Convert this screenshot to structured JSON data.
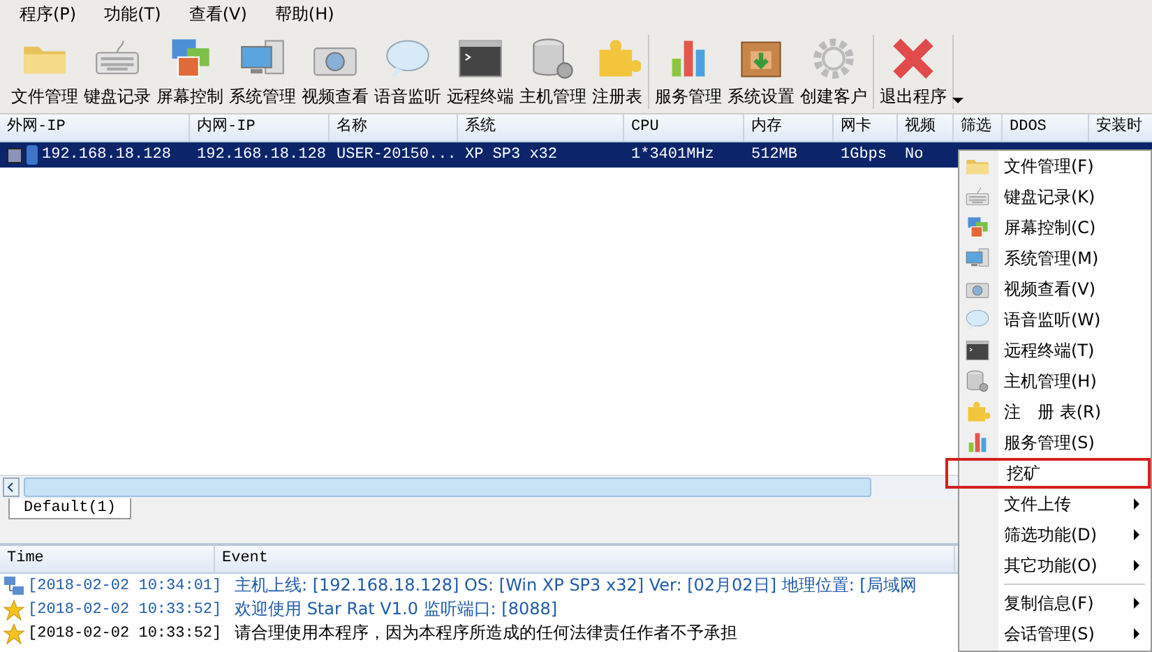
{
  "menu_bar": [
    "程序(P)",
    "功能(T)",
    "查看(V)",
    "帮助(H)"
  ],
  "toolbar": [
    {
      "items": [
        {
          "label": "文件管理",
          "kind": "folder"
        },
        {
          "label": "键盘记录",
          "kind": "keyboard"
        },
        {
          "label": "屏幕控制",
          "kind": "screens"
        },
        {
          "label": "系统管理",
          "kind": "monitor"
        },
        {
          "label": "视频查看",
          "kind": "camera"
        },
        {
          "label": "语音监听",
          "kind": "bubble"
        },
        {
          "label": "远程终端",
          "kind": "terminal"
        },
        {
          "label": "主机管理",
          "kind": "server"
        },
        {
          "label": "注册表",
          "kind": "puzzle"
        }
      ]
    },
    {
      "items": [
        {
          "label": "服务管理",
          "kind": "chart"
        },
        {
          "label": "系统设置",
          "kind": "box"
        },
        {
          "label": "创建客户",
          "kind": "gear"
        }
      ]
    },
    {
      "items": [
        {
          "label": "退出程序",
          "kind": "exit",
          "dropdown": true
        }
      ]
    }
  ],
  "table": {
    "columns": [
      "外网-IP",
      "内网-IP",
      "名称",
      "系统",
      "CPU",
      "内存",
      "网卡",
      "视频",
      "筛选",
      "DDOS",
      "安装时"
    ],
    "rows": [
      {
        "selected": true,
        "checked": false,
        "cells": [
          "192.168.18.128",
          "192.168.18.128",
          "USER-20150...",
          "XP SP3 x32",
          "1*3401MHz",
          "512MB",
          "1Gbps",
          "No"
        ]
      }
    ]
  },
  "tabs": [
    {
      "label": "Default(1)",
      "selected": true
    }
  ],
  "log": {
    "columns": [
      "Time",
      "Event"
    ],
    "rows": [
      {
        "kind": "online",
        "time": "[2018-02-02 10:34:01]",
        "event": "主机上线: [192.168.18.128]   OS: [Win XP SP3 x32]   Ver: [02月02日]   地理位置: [局域网"
      },
      {
        "kind": "notice",
        "time": "[2018-02-02 10:33:52]",
        "event": "欢迎使用 Star Rat  V1.0   监听端口: [8088]"
      },
      {
        "kind": "plain",
        "time": "[2018-02-02 10:33:52]",
        "event": "请合理使用本程序，因为本程序所造成的任何法律责任作者不予承担"
      }
    ]
  },
  "context_menu": [
    {
      "label": "文件管理(F)",
      "kind": "folder"
    },
    {
      "label": "键盘记录(K)",
      "kind": "keyboard"
    },
    {
      "label": "屏幕控制(C)",
      "kind": "screens"
    },
    {
      "label": "系统管理(M)",
      "kind": "monitor"
    },
    {
      "label": "视频查看(V)",
      "kind": "camera"
    },
    {
      "label": "语音监听(W)",
      "kind": "bubble"
    },
    {
      "label": "远程终端(T)",
      "kind": "terminal"
    },
    {
      "label": "主机管理(H)",
      "kind": "server"
    },
    {
      "label": "注　册 表(R)",
      "kind": "puzzle"
    },
    {
      "label": "服务管理(S)",
      "kind": "chart"
    },
    {
      "label": "挖矿",
      "kind": "plain",
      "highlighted": true
    },
    {
      "label": "文件上传",
      "kind": "plain",
      "submenu": true
    },
    {
      "label": "筛选功能(D)",
      "kind": "plain",
      "submenu": true
    },
    {
      "label": "其它功能(O)",
      "kind": "plain",
      "submenu": true
    },
    {
      "label": "复制信息(F)",
      "kind": "plain",
      "submenu": true,
      "separator_before": true
    },
    {
      "label": "会话管理(S)",
      "kind": "plain",
      "submenu": true
    }
  ]
}
